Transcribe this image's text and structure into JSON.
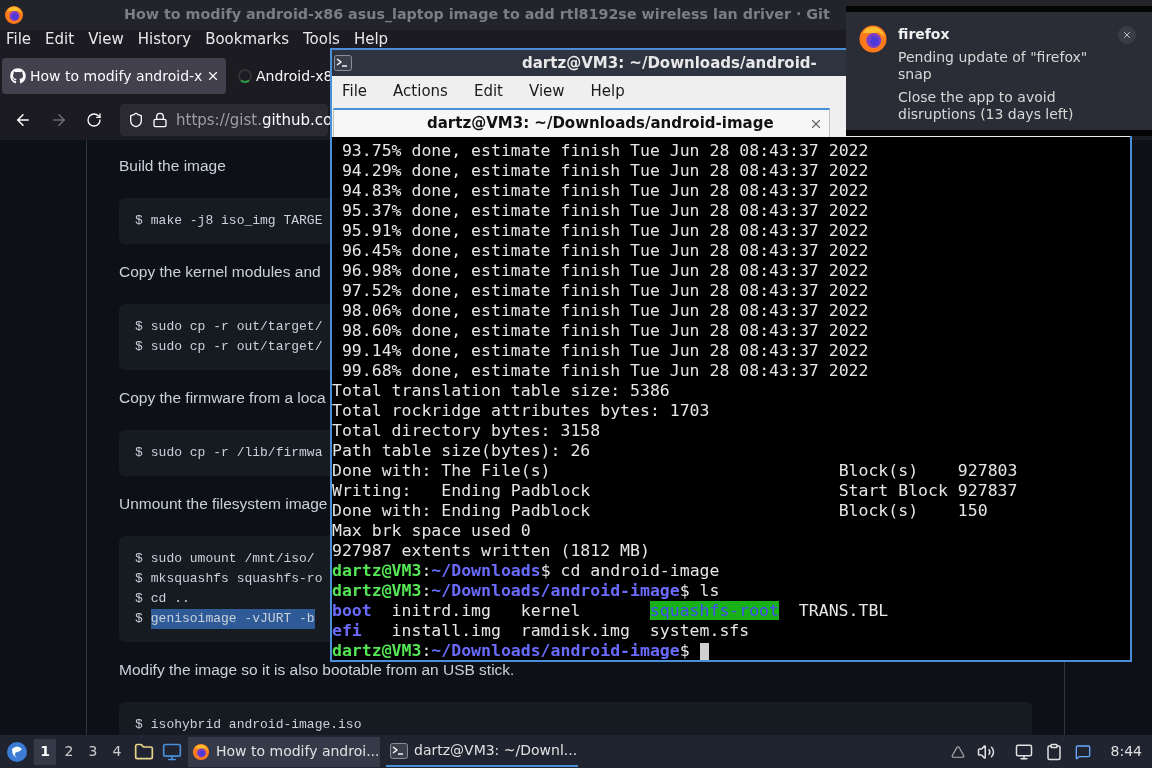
{
  "browser": {
    "title": "How to modify android-x86 asus_laptop image to add rtl8192se wireless lan driver · Git",
    "menu": [
      "File",
      "Edit",
      "View",
      "History",
      "Bookmarks",
      "Tools",
      "Help"
    ],
    "tabs": [
      {
        "label": "How to modify android-x",
        "kind": "github",
        "selected": true
      },
      {
        "label": "Android-x8",
        "kind": "loading",
        "selected": false
      }
    ],
    "url": {
      "prefix": "https://gist.",
      "domain": "github.co"
    }
  },
  "page": {
    "sections": [
      {
        "paragraph": "Build the image",
        "code": [
          {
            "prompt": "$",
            "text": "make -j8 iso_img TARGE",
            "selected": false
          }
        ]
      },
      {
        "paragraph": "Copy the kernel modules and",
        "code": [
          {
            "prompt": "$",
            "text": "sudo cp -r out/target/",
            "selected": false
          },
          {
            "prompt": "$",
            "text": "sudo cp -r out/target/",
            "selected": false
          }
        ]
      },
      {
        "paragraph": "Copy the firmware from a loca",
        "code": [
          {
            "prompt": "$",
            "text": "sudo cp -r /lib/firmwa",
            "selected": false
          }
        ]
      },
      {
        "paragraph": "Unmount the filesystem image",
        "code": [
          {
            "prompt": "$",
            "text": "sudo umount /mnt/iso/",
            "selected": false
          },
          {
            "prompt": "$",
            "text": "mksquashfs squashfs-ro",
            "selected": false
          },
          {
            "prompt": "$",
            "text": "cd ..",
            "selected": false
          },
          {
            "prompt": "$",
            "text": "genisoimage -vJURT -b",
            "selected": true
          }
        ]
      },
      {
        "paragraph": "Modify the image so it is also bootable from an USB stick.",
        "code": [
          {
            "prompt": "$",
            "text": "isohybrid android-image.iso",
            "selected": false
          }
        ]
      }
    ]
  },
  "terminal": {
    "title": "dartz@VM3: ~/Downloads/android-",
    "menu": [
      "File",
      "Actions",
      "Edit",
      "View",
      "Help"
    ],
    "tabs": [
      {
        "label": "dartz@VM3: ~/Downloads/android-image",
        "selected": true
      }
    ],
    "lines": [
      {
        "kind": "text",
        "text": " 93.75% done, estimate finish Tue Jun 28 08:43:37 2022"
      },
      {
        "kind": "text",
        "text": " 94.29% done, estimate finish Tue Jun 28 08:43:37 2022"
      },
      {
        "kind": "text",
        "text": " 94.83% done, estimate finish Tue Jun 28 08:43:37 2022"
      },
      {
        "kind": "text",
        "text": " 95.37% done, estimate finish Tue Jun 28 08:43:37 2022"
      },
      {
        "kind": "text",
        "text": " 95.91% done, estimate finish Tue Jun 28 08:43:37 2022"
      },
      {
        "kind": "text",
        "text": " 96.45% done, estimate finish Tue Jun 28 08:43:37 2022"
      },
      {
        "kind": "text",
        "text": " 96.98% done, estimate finish Tue Jun 28 08:43:37 2022"
      },
      {
        "kind": "text",
        "text": " 97.52% done, estimate finish Tue Jun 28 08:43:37 2022"
      },
      {
        "kind": "text",
        "text": " 98.06% done, estimate finish Tue Jun 28 08:43:37 2022"
      },
      {
        "kind": "text",
        "text": " 98.60% done, estimate finish Tue Jun 28 08:43:37 2022"
      },
      {
        "kind": "text",
        "text": " 99.14% done, estimate finish Tue Jun 28 08:43:37 2022"
      },
      {
        "kind": "text",
        "text": " 99.68% done, estimate finish Tue Jun 28 08:43:37 2022"
      },
      {
        "kind": "text",
        "text": "Total translation table size: 5386"
      },
      {
        "kind": "text",
        "text": "Total rockridge attributes bytes: 1703"
      },
      {
        "kind": "text",
        "text": "Total directory bytes: 3158"
      },
      {
        "kind": "text",
        "text": "Path table size(bytes): 26"
      },
      {
        "kind": "text",
        "text": "Done with: The File(s)                             Block(s)    927803"
      },
      {
        "kind": "text",
        "text": "Writing:   Ending Padblock                         Start Block 927837"
      },
      {
        "kind": "text",
        "text": "Done with: Ending Padblock                         Block(s)    150"
      },
      {
        "kind": "text",
        "text": "Max brk space used 0"
      },
      {
        "kind": "text",
        "text": "927987 extents written (1812 MB)"
      },
      {
        "kind": "prompt",
        "user": "dartz@VM3",
        "sep": ":",
        "path": "~/Downloads",
        "sign": "$",
        "cmd": "cd android-image",
        "cursor": false
      },
      {
        "kind": "prompt",
        "user": "dartz@VM3",
        "sep": ":",
        "path": "~/Downloads/android-image",
        "sign": "$",
        "cmd": "ls",
        "cursor": false
      },
      {
        "kind": "ls",
        "items": [
          {
            "name": "boot",
            "kind": "dir"
          },
          {
            "name": "initrd.img",
            "kind": "file"
          },
          {
            "name": "kernel",
            "kind": "file"
          },
          {
            "name": "squashfs-root",
            "kind": "marked"
          },
          {
            "name": "TRANS.TBL",
            "kind": "file"
          }
        ]
      },
      {
        "kind": "ls",
        "items": [
          {
            "name": "efi",
            "kind": "dir"
          },
          {
            "name": "install.img",
            "kind": "file"
          },
          {
            "name": "ramdisk.img",
            "kind": "file"
          },
          {
            "name": "system.sfs",
            "kind": "file"
          }
        ]
      },
      {
        "kind": "prompt",
        "user": "dartz@VM3",
        "sep": ":",
        "path": "~/Downloads/android-image",
        "sign": "$",
        "cursor": true
      }
    ]
  },
  "notification": {
    "app": "firefox",
    "lines": [
      "Pending update of \"firefox\" snap",
      "Close the app to avoid disruptions (13 days left)"
    ]
  },
  "taskbar": {
    "workspaces": [
      {
        "label": "1",
        "selected": true
      },
      {
        "label": "2",
        "selected": false
      },
      {
        "label": "3",
        "selected": false
      },
      {
        "label": "4",
        "selected": false
      }
    ],
    "tasks": [
      {
        "label": "How to modify androi...",
        "kind": "browser",
        "selected": false
      },
      {
        "label": "dartz@VM3: ~/Downl...",
        "kind": "terminal",
        "selected": true
      }
    ],
    "clock": "8:44"
  }
}
